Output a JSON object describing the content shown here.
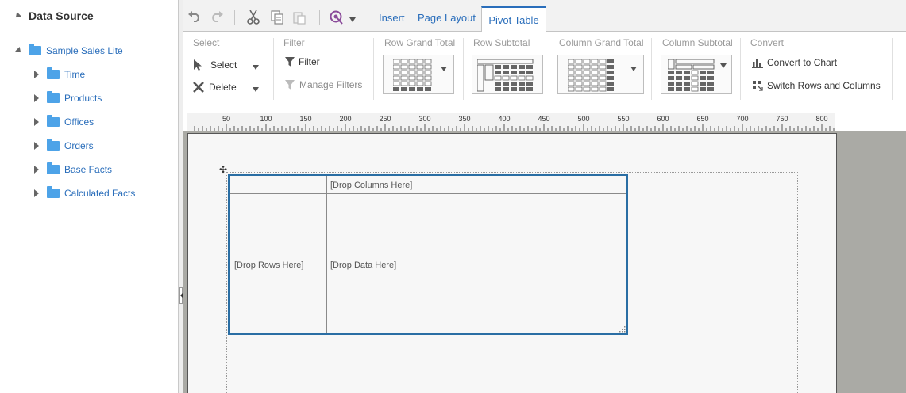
{
  "data_source": {
    "title": "Data Source",
    "root": "Sample Sales Lite",
    "items": [
      "Time",
      "Products",
      "Offices",
      "Orders",
      "Base Facts",
      "Calculated Facts"
    ]
  },
  "toolbar": {
    "tabs": {
      "insert": "Insert",
      "page_layout": "Page Layout",
      "pivot_table": "Pivot Table"
    },
    "icons": [
      "undo-icon",
      "redo-icon",
      "cut-icon",
      "copy-icon",
      "paste-icon",
      "preview-icon"
    ]
  },
  "ribbon": {
    "select": {
      "title": "Select",
      "select_label": "Select",
      "delete_label": "Delete"
    },
    "filter": {
      "title": "Filter",
      "filter_label": "Filter",
      "manage_label": "Manage Filters"
    },
    "row_grand_total": {
      "title": "Row Grand Total"
    },
    "row_subtotal": {
      "title": "Row Subtotal"
    },
    "column_grand_total": {
      "title": "Column Grand Total"
    },
    "column_subtotal": {
      "title": "Column Subtotal"
    },
    "convert": {
      "title": "Convert",
      "to_chart_label": "Convert to Chart",
      "switch_label": "Switch Rows and Columns"
    }
  },
  "ruler": {
    "labels": [
      "50",
      "100",
      "150",
      "200",
      "250",
      "300",
      "350",
      "400",
      "450",
      "500",
      "550",
      "600",
      "650",
      "700",
      "750",
      "800"
    ]
  },
  "pivot": {
    "drop_columns": "[Drop Columns Here]",
    "drop_rows": "[Drop Rows Here]",
    "drop_data": "[Drop Data Here]"
  },
  "colors": {
    "accent": "#2a6ebb",
    "pivot_border": "#2a6ea4",
    "folder": "#4da3e8",
    "canvas_bg": "#aaaaa5"
  }
}
